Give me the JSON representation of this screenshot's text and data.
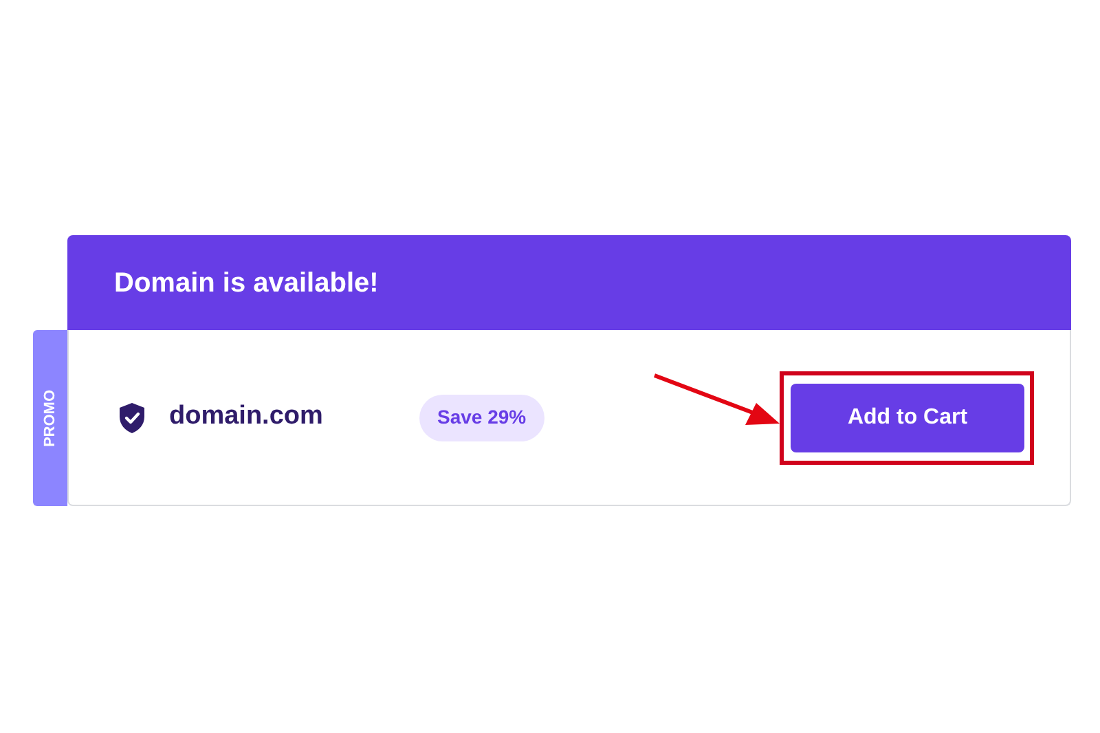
{
  "header": {
    "title": "Domain is available!"
  },
  "promo_tab": {
    "label": "PROMO"
  },
  "result": {
    "domain": "domain.com",
    "badge": "Save 29%",
    "button": "Add to Cart"
  }
}
